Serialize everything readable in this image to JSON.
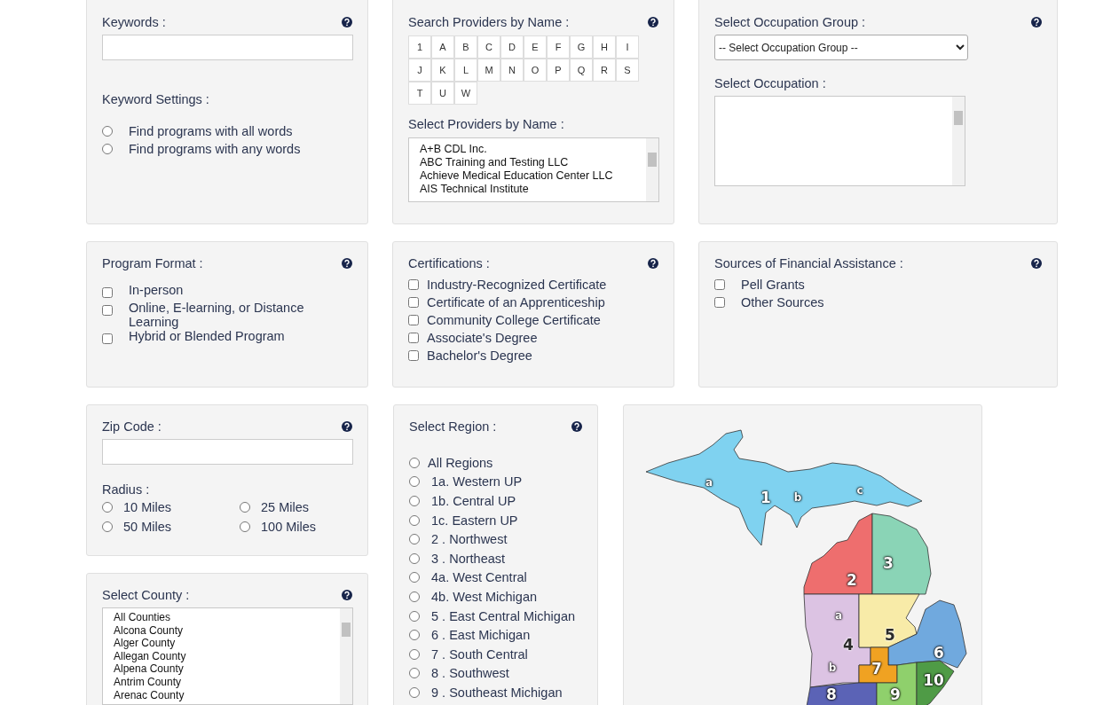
{
  "keywords": {
    "label": "Keywords :"
  },
  "keyword_settings": {
    "label": "Keyword Settings :",
    "options": [
      {
        "label": "Find programs with all words",
        "selected": false
      },
      {
        "label": "Find programs with any words",
        "selected": false
      }
    ]
  },
  "providers": {
    "label": "Search Providers by Name :",
    "letters": [
      "1",
      "A",
      "B",
      "C",
      "D",
      "E",
      "F",
      "G",
      "H",
      "I",
      "J",
      "K",
      "L",
      "M",
      "N",
      "O",
      "P",
      "Q",
      "R",
      "S",
      "T",
      "U",
      "W"
    ],
    "list_label": "Select Providers by Name :",
    "items": [
      "A+B CDL Inc.",
      "ABC Training and Testing LLC",
      "Achieve Medical Education Center LLC",
      "AIS Technical Institute"
    ]
  },
  "occupation_group": {
    "label": "Select Occupation Group :",
    "select_placeholder": "-- Select Occupation Group --"
  },
  "occupation": {
    "label": "Select Occupation :"
  },
  "program_format": {
    "label": "Program Format :",
    "options": [
      {
        "label": "In-person",
        "checked": false
      },
      {
        "label": "Online, E-learning, or Distance Learning",
        "checked": false
      },
      {
        "label": "Hybrid or Blended Program",
        "checked": false
      }
    ]
  },
  "certifications": {
    "label": "Certifications :",
    "options": [
      {
        "label": "Industry-Recognized Certificate",
        "checked": false
      },
      {
        "label": "Certificate of an Apprenticeship",
        "checked": false
      },
      {
        "label": "Community College Certificate",
        "checked": false
      },
      {
        "label": "Associate's Degree",
        "checked": false
      },
      {
        "label": "Bachelor's Degree",
        "checked": false
      }
    ]
  },
  "financial_assistance": {
    "label": "Sources of Financial Assistance :",
    "options": [
      {
        "label": "Pell Grants",
        "checked": false
      },
      {
        "label": "Other Sources",
        "checked": false
      }
    ]
  },
  "zip_code": {
    "label": "Zip Code :"
  },
  "radius": {
    "label": "Radius :",
    "options": [
      {
        "label": "10 Miles",
        "selected": false
      },
      {
        "label": "25 Miles",
        "selected": false
      },
      {
        "label": "50 Miles",
        "selected": false
      },
      {
        "label": "100 Miles",
        "selected": false
      }
    ]
  },
  "county": {
    "label": "Select County :",
    "items": [
      "All Counties",
      "Alcona County",
      "Alger County",
      "Allegan County",
      "Alpena County",
      "Antrim County",
      "Arenac County"
    ]
  },
  "region": {
    "label": "Select Region :",
    "options": [
      {
        "label": "All Regions",
        "selected": false
      },
      {
        "label": " 1a. Western UP",
        "selected": false
      },
      {
        "label": " 1b. Central UP",
        "selected": false
      },
      {
        "label": " 1c. Eastern UP",
        "selected": false
      },
      {
        "label": " 2 . Northwest",
        "selected": false
      },
      {
        "label": " 3 . Northeast",
        "selected": false
      },
      {
        "label": " 4a. West Central",
        "selected": false
      },
      {
        "label": " 4b. West Michigan",
        "selected": false
      },
      {
        "label": " 5 . East Central Michigan",
        "selected": false
      },
      {
        "label": " 6 . East Michigan",
        "selected": false
      },
      {
        "label": " 7 . South Central",
        "selected": false
      },
      {
        "label": " 8 . Southwest",
        "selected": false
      },
      {
        "label": " 9 . Southeast Michigan",
        "selected": false
      }
    ]
  },
  "map": {
    "regions": [
      {
        "label": "1",
        "color": "#7fd2f0"
      },
      {
        "label": "2",
        "color": "#ee6e6e"
      },
      {
        "label": "3",
        "color": "#8ad4b6"
      },
      {
        "label": "4",
        "color": "#dcc3e3"
      },
      {
        "label": "5",
        "color": "#f8eba8"
      },
      {
        "label": "6",
        "color": "#70a9de"
      },
      {
        "label": "7",
        "color": "#f0a222"
      },
      {
        "label": "8",
        "color": "#5b63b6"
      },
      {
        "label": "9",
        "color": "#8fd06c"
      },
      {
        "label": "10",
        "color": "#4f9b46"
      }
    ],
    "sublabels": [
      "a",
      "b",
      "c",
      "a",
      "b"
    ]
  }
}
